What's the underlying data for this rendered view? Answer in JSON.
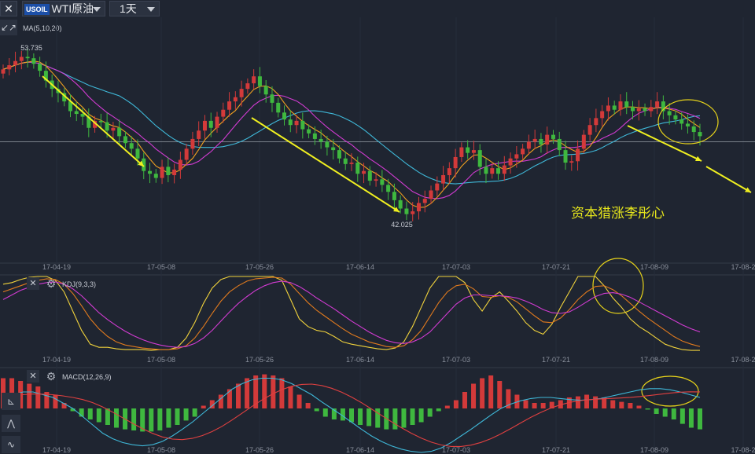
{
  "toolbar": {
    "close_label": "✕",
    "symbol_badge": "USOIL",
    "symbol_name": "WTI原油",
    "period": "1天",
    "expand_icon": "↙↗"
  },
  "price_panel": {
    "indicator": "MA(5,10,20)"
  },
  "kdj_panel": {
    "indicator": "KDJ(9,3,3)",
    "close_label": "✕"
  },
  "macd_panel": {
    "indicator": "MACD(12,26,9)",
    "close_label": "✕"
  },
  "watermark": "资本猎涨李彤心",
  "colors": {
    "background": "#1f2531",
    "up": "#d33a3a",
    "down": "#3fb83f",
    "ma5": "#f0a020",
    "ma10": "#d13bd1",
    "ma20": "#3fb8d8",
    "arrow": "#f0f020",
    "circle": "#e6d21a",
    "kdj_k": "#f0d23c",
    "kdj_d": "#e07a1e",
    "kdj_j": "#d13bd1",
    "macd_dif": "#3fb8d8",
    "macd_dea": "#e04040"
  },
  "chart_data": [
    {
      "type": "candlestick",
      "indicator": "MA(5,10,20)",
      "x_ticks": [
        "17-04-19",
        "17-05-08",
        "17-05-26",
        "17-06-14",
        "17-07-03",
        "17-07-21",
        "17-08-09",
        "17-08-2"
      ],
      "annotations": {
        "high_label": "53.735",
        "low_label": "42.025"
      },
      "close": [
        52.6,
        52.9,
        53.2,
        53.5,
        53.4,
        53.0,
        52.5,
        51.8,
        51.2,
        50.9,
        50.3,
        49.6,
        49.4,
        49.2,
        48.4,
        48.9,
        48.8,
        48.2,
        48.4,
        47.8,
        47.3,
        46.9,
        46.2,
        45.3,
        45.1,
        44.8,
        45.6,
        45.0,
        45.4,
        46.1,
        46.9,
        47.6,
        48.2,
        48.9,
        48.4,
        49.2,
        49.7,
        50.3,
        50.6,
        51.2,
        51.6,
        52.1,
        51.4,
        50.8,
        50.2,
        49.5,
        49.0,
        48.6,
        48.9,
        48.3,
        48.0,
        47.6,
        47.4,
        47.0,
        46.8,
        46.2,
        45.8,
        45.9,
        45.1,
        45.3,
        44.6,
        44.7,
        44.3,
        43.8,
        43.2,
        42.6,
        42.2,
        42.4,
        43.0,
        43.3,
        43.9,
        44.4,
        45.0,
        45.5,
        46.3,
        47.0,
        46.6,
        46.8,
        45.6,
        45.1,
        45.5,
        45.1,
        45.7,
        46.2,
        46.5,
        46.9,
        47.4,
        47.6,
        47.2,
        47.9,
        47.6,
        46.8,
        45.9,
        46.0,
        46.9,
        47.9,
        48.6,
        49.1,
        49.6,
        50.0,
        49.7,
        50.3,
        49.9,
        49.6,
        49.8,
        49.6,
        49.9,
        50.3,
        49.6,
        49.3,
        49.0,
        48.7,
        48.5,
        48.1,
        47.8
      ]
    },
    {
      "type": "line",
      "indicator": "KDJ(9,3,3)",
      "series": [
        {
          "name": "K",
          "values": [
            90,
            92,
            96,
            99,
            100,
            100,
            95,
            80,
            55,
            30,
            12,
            8,
            8,
            6,
            5,
            5,
            5,
            4,
            5,
            5,
            8,
            20,
            40,
            65,
            85,
            96,
            100,
            100,
            100,
            100,
            100,
            100,
            95,
            70,
            45,
            35,
            30,
            28,
            22,
            15,
            12,
            10,
            8,
            6,
            5,
            7,
            15,
            35,
            60,
            85,
            100,
            100,
            100,
            92,
            70,
            55,
            72,
            80,
            68,
            55,
            40,
            30,
            25,
            38,
            60,
            80,
            100,
            100,
            100,
            88,
            72,
            60,
            45,
            35,
            28,
            20,
            12,
            8,
            5,
            4,
            4
          ]
        },
        {
          "name": "D",
          "values": [
            80,
            84,
            88,
            92,
            95,
            97,
            96,
            90,
            78,
            62,
            45,
            32,
            22,
            15,
            11,
            9,
            7,
            6,
            5,
            5,
            6,
            10,
            20,
            35,
            52,
            68,
            80,
            88,
            94,
            97,
            98,
            99,
            98,
            90,
            78,
            66,
            56,
            48,
            40,
            32,
            25,
            20,
            15,
            12,
            9,
            8,
            10,
            18,
            30,
            48,
            66,
            80,
            88,
            90,
            84,
            74,
            73,
            75,
            73,
            67,
            58,
            49,
            41,
            40,
            46,
            57,
            70,
            80,
            87,
            88,
            83,
            75,
            65,
            55,
            46,
            38,
            30,
            22,
            16,
            12,
            9
          ]
        },
        {
          "name": "J",
          "values": [
            70,
            76,
            82,
            86,
            90,
            92,
            93,
            90,
            84,
            75,
            64,
            53,
            44,
            36,
            29,
            23,
            18,
            14,
            11,
            9,
            8,
            9,
            13,
            20,
            30,
            42,
            54,
            65,
            74,
            82,
            88,
            92,
            94,
            92,
            87,
            80,
            72,
            65,
            58,
            50,
            42,
            35,
            28,
            22,
            17,
            14,
            13,
            15,
            20,
            28,
            40,
            52,
            64,
            72,
            76,
            76,
            75,
            75,
            74,
            72,
            68,
            63,
            57,
            53,
            52,
            54,
            60,
            67,
            74,
            78,
            79,
            77,
            73,
            67,
            61,
            55,
            49,
            43,
            37,
            32,
            28
          ]
        }
      ]
    },
    {
      "type": "bar",
      "indicator": "MACD(12,26,9)",
      "histogram": [
        0.55,
        0.55,
        0.5,
        0.45,
        0.4,
        0.3,
        0.25,
        0.1,
        -0.05,
        -0.15,
        -0.2,
        -0.25,
        -0.3,
        -0.35,
        -0.38,
        -0.4,
        -0.42,
        -0.42,
        -0.4,
        -0.35,
        -0.3,
        -0.22,
        -0.15,
        0.05,
        0.15,
        0.25,
        0.35,
        0.45,
        0.55,
        0.6,
        0.62,
        0.6,
        0.55,
        0.4,
        0.25,
        0.1,
        -0.05,
        -0.15,
        -0.2,
        -0.22,
        -0.25,
        -0.3,
        -0.32,
        -0.35,
        -0.38,
        -0.38,
        -0.35,
        -0.3,
        -0.25,
        -0.15,
        -0.05,
        0.05,
        0.15,
        0.3,
        0.45,
        0.55,
        0.6,
        0.5,
        0.35,
        0.25,
        0.15,
        0.1,
        0.1,
        0.12,
        0.15,
        0.2,
        0.22,
        0.25,
        0.22,
        0.2,
        0.15,
        0.12,
        0.1,
        0.05,
        -0.02,
        -0.1,
        -0.15,
        -0.2,
        -0.28,
        -0.35,
        -0.38
      ],
      "dif": [
        0.2,
        0.25,
        0.3,
        0.3,
        0.25,
        0.2,
        0.1,
        0.0,
        -0.15,
        -0.3,
        -0.45,
        -0.55,
        -0.62,
        -0.66,
        -0.68,
        -0.66,
        -0.6,
        -0.5,
        -0.38,
        -0.25,
        -0.1,
        0.05,
        0.2,
        0.35,
        0.45,
        0.52,
        0.55,
        0.55,
        0.52,
        0.45,
        0.35,
        0.25,
        0.12,
        0.0,
        -0.12,
        -0.25,
        -0.38,
        -0.5,
        -0.6,
        -0.68,
        -0.74,
        -0.78,
        -0.8,
        -0.78,
        -0.72,
        -0.62,
        -0.5,
        -0.38,
        -0.25,
        -0.12,
        0.0,
        0.08,
        0.14,
        0.18,
        0.2,
        0.2,
        0.18,
        0.16,
        0.15,
        0.16,
        0.18,
        0.22,
        0.26,
        0.3,
        0.34,
        0.36,
        0.36,
        0.34,
        0.3,
        0.25,
        0.2
      ]
    }
  ]
}
